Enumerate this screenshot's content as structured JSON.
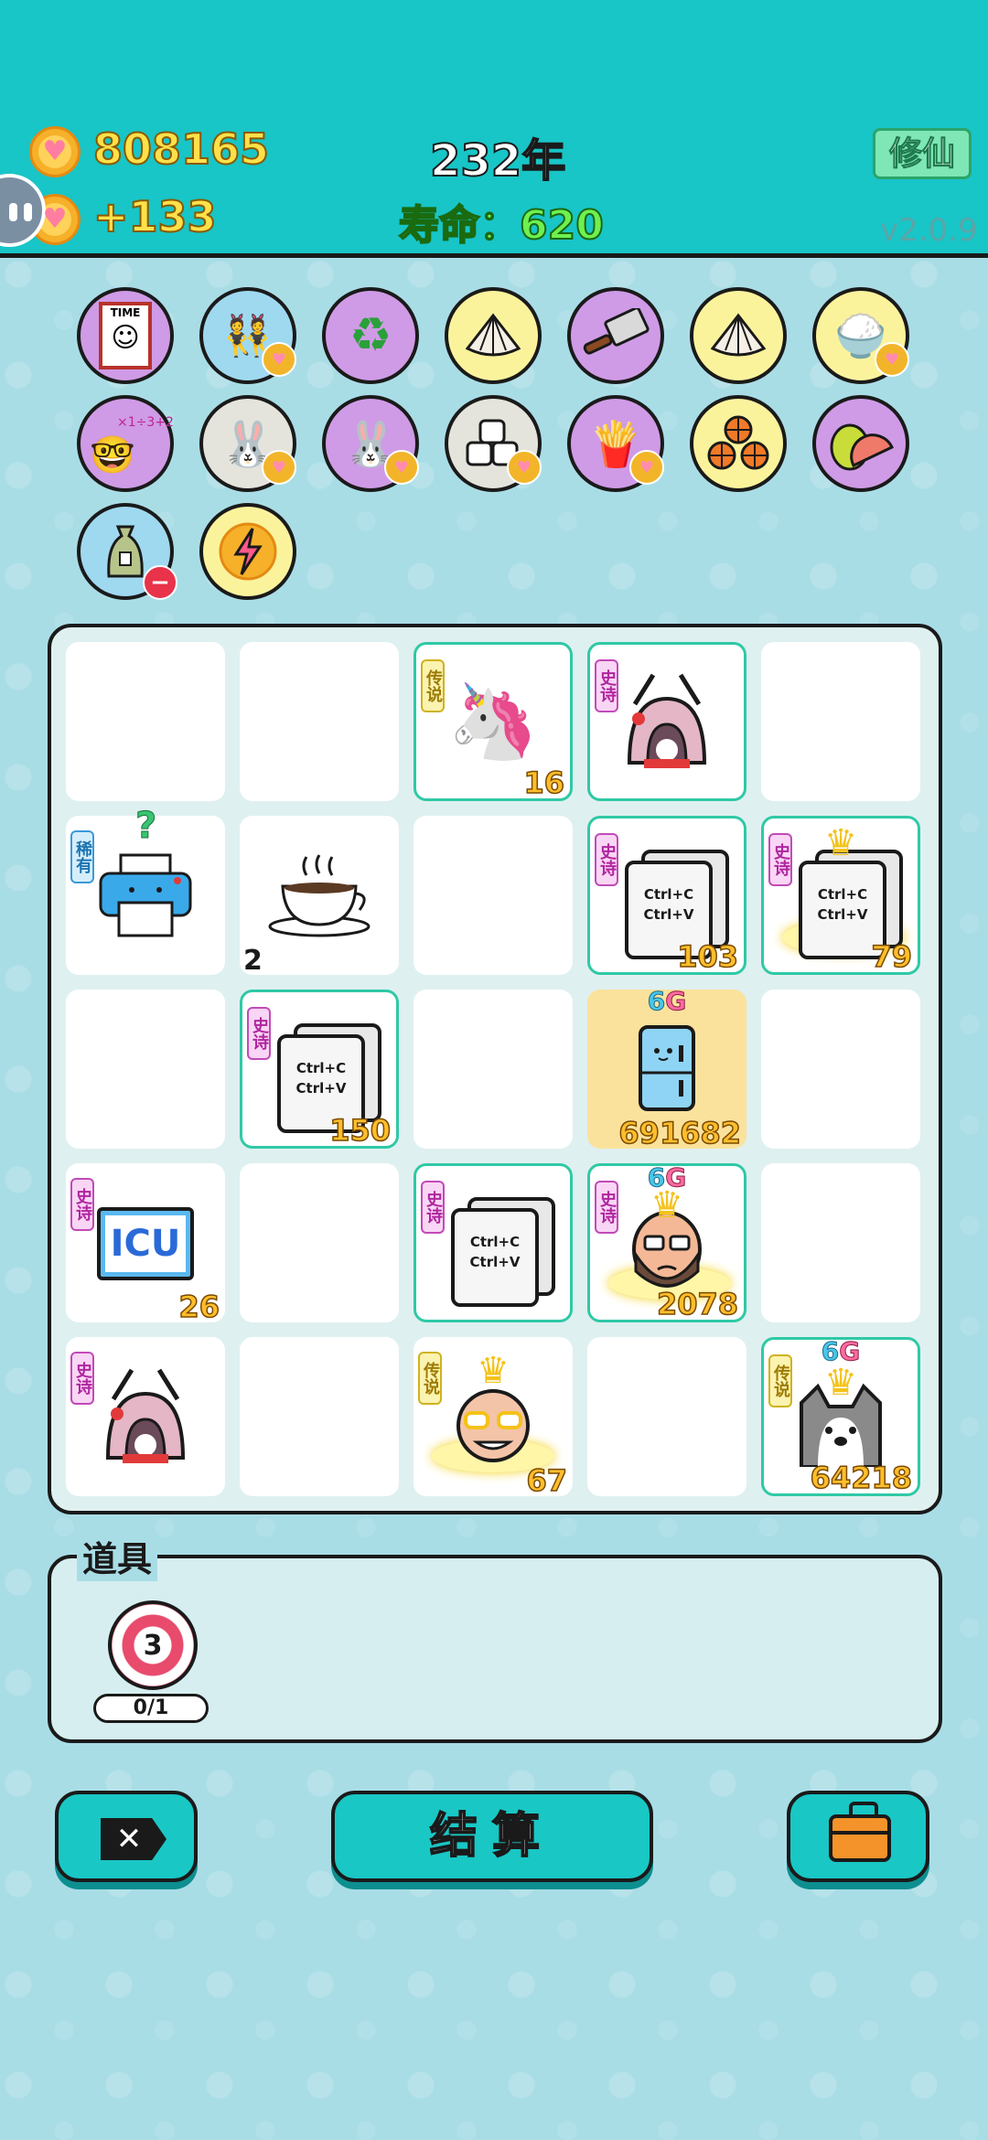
{
  "header": {
    "coins": "808165",
    "income": "+133",
    "year": "232年",
    "lifespan": "寿命：620",
    "cultivate_button": "修仙",
    "version": "v2.0.9"
  },
  "collection": {
    "row1": [
      "time-magazine-icon",
      "twins-icon",
      "recycle-icon",
      "shell-icon",
      "cleaver-icon",
      "shell-icon",
      "rice-bowl-icon"
    ],
    "row2": [
      "math-nerd-icon",
      "rabbit-icon",
      "rabbit-icon",
      "tofu-icon",
      "fries-icon",
      "basketballs-icon",
      "grapefruit-icon"
    ],
    "row3": [
      "trash-bag-icon",
      "lightning-icon"
    ]
  },
  "board": {
    "cells": [
      {
        "tag": "",
        "count": ""
      },
      {
        "tag": "",
        "count": ""
      },
      {
        "tag": "传说",
        "count": "16"
      },
      {
        "tag": "史诗",
        "count": ""
      },
      {
        "tag": "",
        "count": ""
      },
      {
        "tag": "稀有",
        "count": ""
      },
      {
        "tag": "",
        "count": "2"
      },
      {
        "tag": "",
        "count": ""
      },
      {
        "tag": "史诗",
        "count": "103"
      },
      {
        "tag": "史诗",
        "count": "79"
      },
      {
        "tag": "",
        "count": ""
      },
      {
        "tag": "史诗",
        "count": "150"
      },
      {
        "tag": "",
        "count": ""
      },
      {
        "tag": "",
        "count": "691682",
        "badge": "6G"
      },
      {
        "tag": "",
        "count": ""
      },
      {
        "tag": "史诗",
        "count": "26"
      },
      {
        "tag": "",
        "count": ""
      },
      {
        "tag": "史诗",
        "count": ""
      },
      {
        "tag": "史诗",
        "count": "2078",
        "badge": "6G"
      },
      {
        "tag": "",
        "count": ""
      },
      {
        "tag": "史诗",
        "count": ""
      },
      {
        "tag": "",
        "count": ""
      },
      {
        "tag": "传说",
        "count": "67"
      },
      {
        "tag": "",
        "count": ""
      },
      {
        "tag": "传说",
        "count": "64218",
        "badge": "6G"
      }
    ],
    "copy_text_top": "Ctrl+C",
    "copy_text_bottom": "Ctrl+V",
    "icu_text": "ICU",
    "rare_mark": "?"
  },
  "props": {
    "title": "道具",
    "target_number": "3",
    "target_uses": "0/1"
  },
  "buttons": {
    "settle": "结算"
  },
  "colors": {
    "header_bg": "#18c5c7",
    "page_bg": "#a9dde6",
    "coin_text": "#ffe04a",
    "life_text": "#6ff050",
    "epic_tag": "#c24ab8",
    "legend_tag": "#d0b21e"
  }
}
